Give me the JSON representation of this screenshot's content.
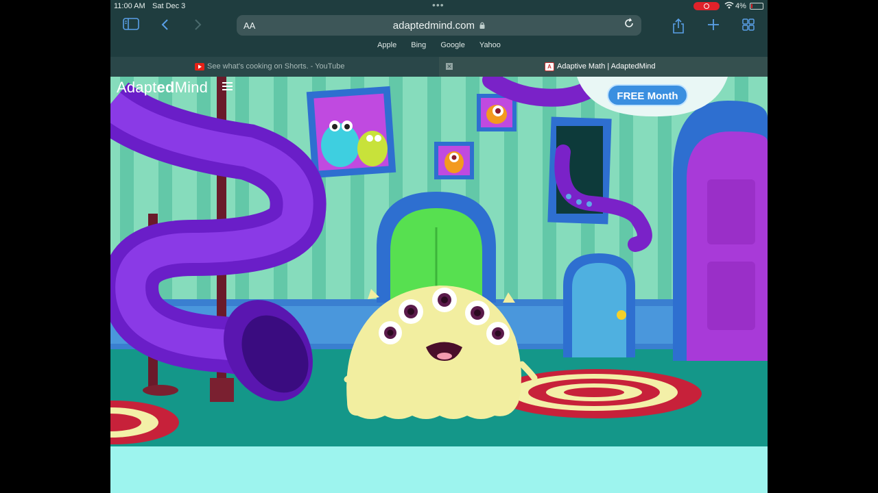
{
  "status_bar": {
    "time": "11:00 AM",
    "date": "Sat Dec 3",
    "battery": "4%"
  },
  "toolbar": {
    "text_size_label": "AA",
    "url": "adaptedmind.com",
    "icons": [
      "sidebar-icon",
      "back-icon",
      "forward-icon",
      "lock-icon",
      "reload-icon",
      "share-icon",
      "plus-icon",
      "tabs-grid-icon"
    ]
  },
  "favorites": [
    "Apple",
    "Bing",
    "Google",
    "Yahoo"
  ],
  "tabs": [
    {
      "title": "See what's cooking on Shorts. - YouTube",
      "favicon_color": "#e62117"
    },
    {
      "title": "Adaptive Math | AdaptedMind",
      "favicon_color": "#d02030"
    }
  ],
  "page": {
    "logo_prefix": "Adapt",
    "logo_bold": "ed",
    "logo_suffix": "Mind",
    "promo_button": "FREE Month",
    "colors": {
      "wall": "#7fd8b8",
      "stripe": "#5fc4a6",
      "floor": "#129588",
      "slide": "#7a22d8",
      "monster": "#f4f0a0",
      "door": "#9a2fc8",
      "footer": "#9df4ee"
    }
  }
}
